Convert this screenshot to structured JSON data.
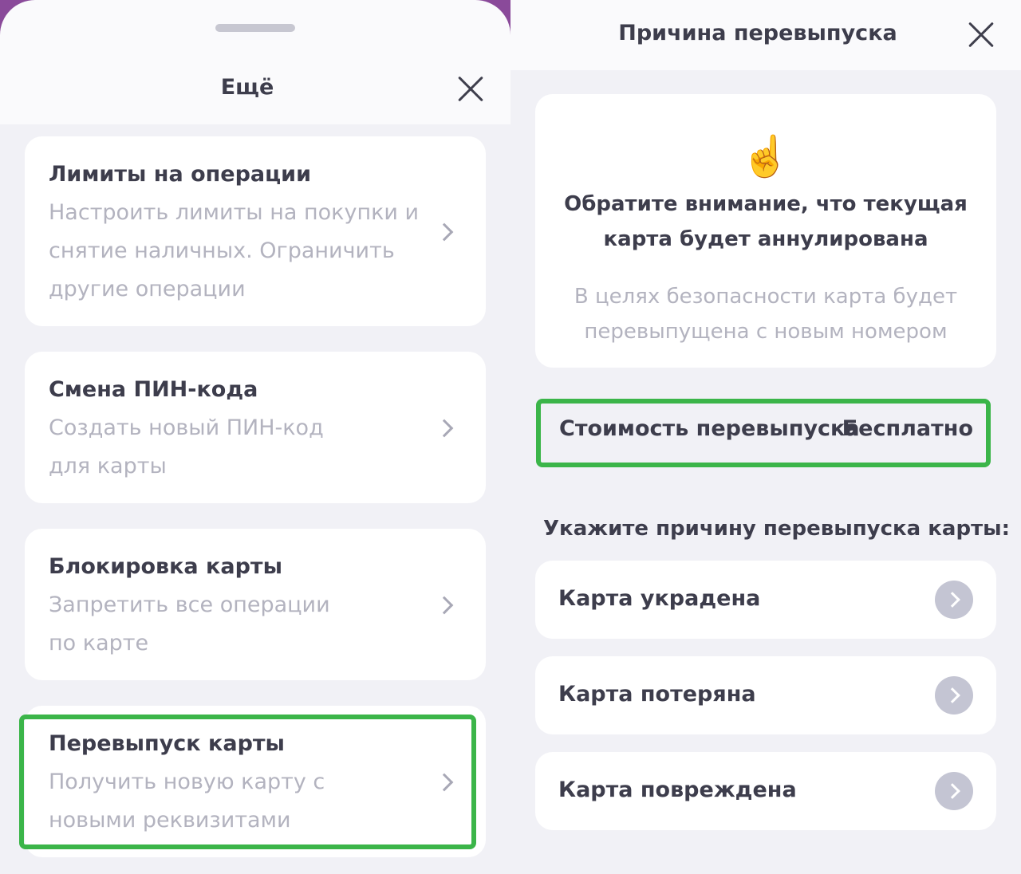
{
  "left_sheet": {
    "title": "Ещё",
    "items": [
      {
        "title": "Лимиты на операции",
        "description": "Настроить лимиты на покупки и снятие наличных. Ограничить другие операции"
      },
      {
        "title": "Смена ПИН-кода",
        "description": "Создать новый ПИН-код для карты"
      },
      {
        "title": "Блокировка карты",
        "description": "Запретить все операции по карте"
      },
      {
        "title": "Перевыпуск карты",
        "description": "Получить новую карту с новыми реквизитами"
      }
    ]
  },
  "right_sheet": {
    "title": "Причина перевыпуска",
    "notice": {
      "emoji": "☝️",
      "title": "Обратите внимание, что текущая карта будет аннулирована",
      "subtitle": "В целях безопасности карта будет перевыпущена с новым номером"
    },
    "cost": {
      "label": "Стоимость перевыпуска",
      "value": "Бесплатно"
    },
    "reason_prompt": "Укажите причину перевыпуска карты:",
    "reasons": [
      "Карта украдена",
      "Карта потеряна",
      "Карта повреждена"
    ]
  },
  "colors": {
    "highlight": "#3bb549",
    "accent_bg": "#8a4a9a",
    "muted_text": "#b3b3bf"
  },
  "icons": {
    "close": "close-icon",
    "chevron": "chevron-right-icon",
    "hand": "index-finger-up-emoji"
  }
}
